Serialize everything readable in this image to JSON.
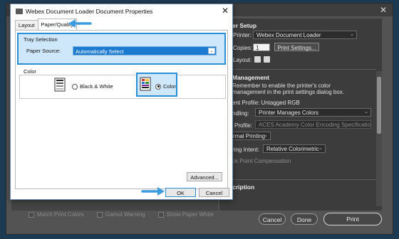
{
  "photoshop": {
    "printer_setup": {
      "heading": "er Setup",
      "printer_label": "Printer:",
      "printer_value": "Webex Document Loader",
      "copies_label": "Copies:",
      "copies_value": "1",
      "print_settings_label": "Print Settings...",
      "layout_label": "Layout:"
    },
    "color_management": {
      "heading": "Management",
      "note_line1": "Remember to enable the printer's color",
      "note_line2": "management in the print settings dialog box.",
      "profile_text": "ent Profile: Untagged RGB",
      "handling_label": "ndling:",
      "handling_value": "Printer Manages Colors",
      "printer_profile_label": "Profile:",
      "printer_profile_value": "ACES Academy Color Encoding Specification...",
      "normal_printing_value": "rmal Printing",
      "rendering_label": "ring Intent:",
      "rendering_value": "Relative Colorimetric",
      "bpc_label": "ck Point Compensation"
    },
    "description_heading": "cription",
    "footer_options": [
      "Match Print Colors",
      "Gamut Warning",
      "Show Paper White"
    ],
    "buttons": {
      "cancel": "Cancel",
      "done": "Done",
      "print": "Print"
    }
  },
  "dialog": {
    "title": "Webex Document Loader Document Properties",
    "tabs": [
      "Layout",
      "Paper/Quality"
    ],
    "tray_selection": {
      "label": "Tray Selection",
      "paper_source_label": "Paper Source:",
      "paper_source_value": "Automatically Select"
    },
    "color": {
      "label": "Color",
      "options": [
        {
          "label": "Black & White",
          "selected": false
        },
        {
          "label": "Color",
          "selected": true
        }
      ]
    },
    "advanced_label": "Advanced...",
    "ok_label": "OK",
    "cancel_label": "Cancel"
  },
  "colors": {
    "highlight": "#2b8fd6",
    "highlight_fill": "#cfe7fb",
    "select_blue": "#1c7ad0",
    "arrow": "#3a9be0"
  },
  "icons": [
    "printer-bw-icon",
    "printer-color-icon",
    "arrow-icon",
    "close-icon",
    "window-icon"
  ]
}
